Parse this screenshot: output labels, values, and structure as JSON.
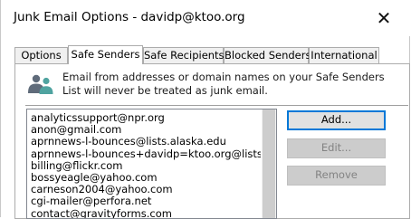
{
  "window": {
    "title": "Junk Email Options - davidp@ktoo.org",
    "close_glyph": "✕"
  },
  "tabs": [
    {
      "label": "Options"
    },
    {
      "label": "Safe Senders"
    },
    {
      "label": "Safe Recipients"
    },
    {
      "label": "Blocked Senders"
    },
    {
      "label": "International"
    }
  ],
  "active_tab": "Safe Senders",
  "info": {
    "icon": "people-icon",
    "text": "Email from addresses or domain names on your Safe Senders List will never be treated as junk email."
  },
  "safe_senders": [
    "analyticssupport@npr.org",
    "anon@gmail.com",
    "aprnnews-l-bounces@lists.alaska.edu",
    "aprnnews-l-bounces+davidp=ktoo.org@lists.alaska.edu",
    "billing@flickr.com",
    "bossyeagle@yahoo.com",
    "carneson2004@yahoo.com",
    "cgi-mailer@perfora.net",
    "contact@gravityforms.com"
  ],
  "buttons": {
    "add": "Add...",
    "edit": "Edit...",
    "remove": "Remove"
  },
  "colors": {
    "focus_border": "#0078d7",
    "icon_gray": "#5f6b7a",
    "icon_teal": "#4fa3a0"
  }
}
